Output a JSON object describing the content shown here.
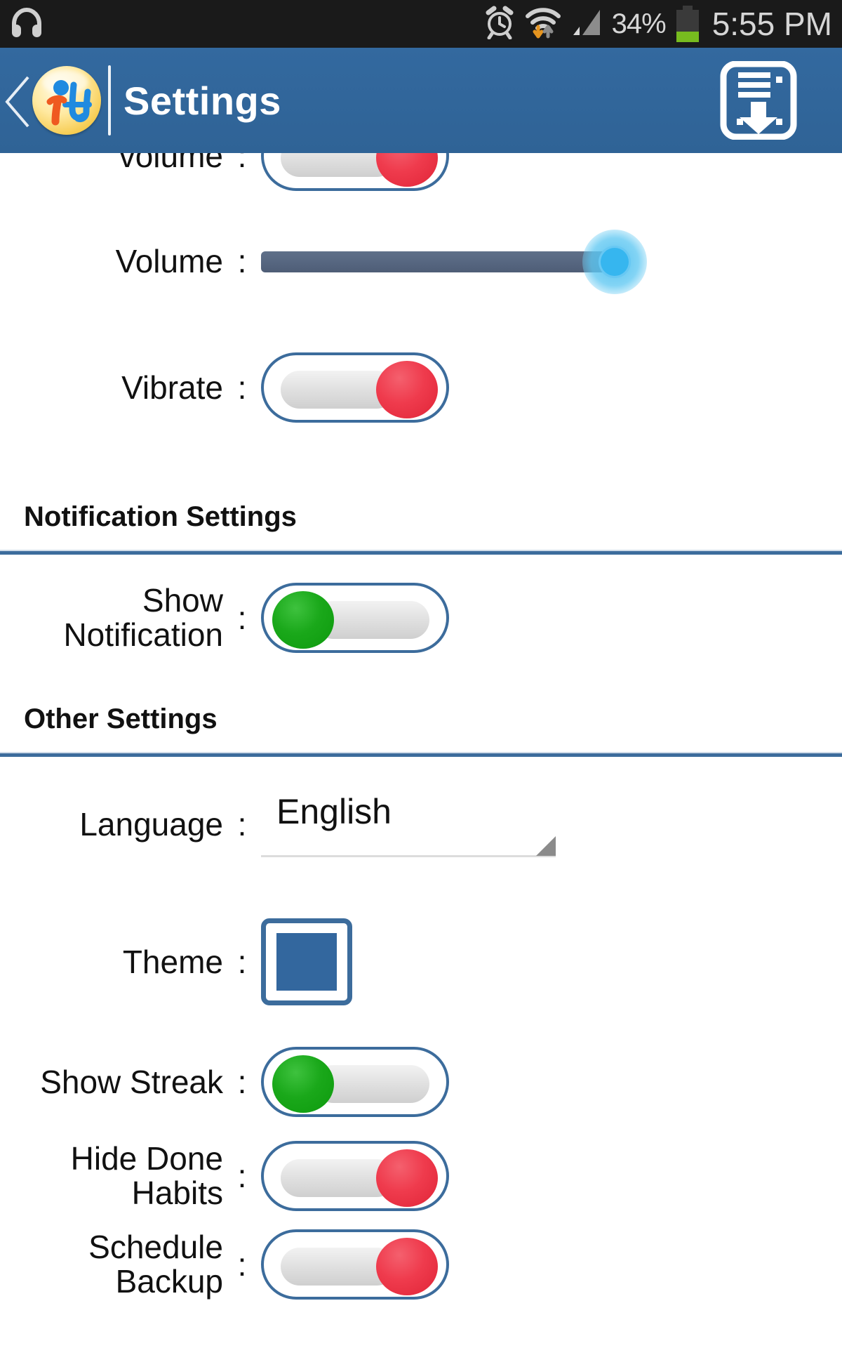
{
  "statusbar": {
    "headphones_icon": "headphones-icon",
    "alarm_icon": "alarm-clock-icon",
    "wifi_icon": "wifi-icon",
    "signal_icon": "cellular-signal-icon",
    "battery_icon": "battery-icon",
    "battery_percent": "34%",
    "time": "5:55 PM",
    "bg_color": "#1a1a1a",
    "text_color": "#d6d6d6",
    "battery_fill_color": "#77bb1f"
  },
  "appbar": {
    "back_icon": "back-chevron-icon",
    "logo_icon": "app-logo-icon",
    "logo_text_i": "i",
    "logo_text_h": "H",
    "title": "Settings",
    "save_icon": "save-floppy-download-icon",
    "bg_color": "#33699f",
    "title_color": "#ffffff"
  },
  "theme_colors": {
    "accent_blue": "#3c6c9c",
    "theme_chip": "#33679e",
    "toggle_on": "#0d9a0d",
    "toggle_off": "#e02437",
    "slider_track": "#566680",
    "slider_thumb": "#36b6ef",
    "divider": "#3c6c9c"
  },
  "sections": [
    {
      "id": "sound",
      "header": null,
      "rows": [
        {
          "label": "volume",
          "colon": ":",
          "control": "toggle",
          "state": "off",
          "clipped": true
        },
        {
          "label": "Volume",
          "colon": ":",
          "control": "slider",
          "value": 100
        },
        {
          "label": "Vibrate",
          "colon": ":",
          "control": "toggle",
          "state": "off"
        }
      ]
    },
    {
      "id": "notification",
      "header": "Notification Settings",
      "rows": [
        {
          "label": "Show\nNotification",
          "colon": ":",
          "control": "toggle",
          "state": "on"
        }
      ]
    },
    {
      "id": "other",
      "header": "Other Settings",
      "rows": [
        {
          "label": "Language",
          "colon": ":",
          "control": "spinner",
          "value": "English"
        },
        {
          "label": "Theme",
          "colon": ":",
          "control": "swatch",
          "value": "#33679e"
        },
        {
          "label": "Show Streak",
          "colon": ":",
          "control": "toggle",
          "state": "on"
        },
        {
          "label": "Hide Done\nHabits",
          "colon": ":",
          "control": "toggle",
          "state": "off"
        },
        {
          "label": "Schedule\nBackup",
          "colon": ":",
          "control": "toggle",
          "state": "off"
        }
      ]
    }
  ],
  "labels": {
    "volume_partial": "volume",
    "volume": "Volume",
    "vibrate": "Vibrate",
    "notification_settings": "Notification Settings",
    "show_notification_l1": "Show",
    "show_notification_l2": "Notification",
    "other_settings": "Other Settings",
    "language": "Language",
    "language_value": "English",
    "theme": "Theme",
    "show_streak": "Show Streak",
    "hide_done_l1": "Hide Done",
    "hide_done_l2": "Habits",
    "schedule_backup_l1": "Schedule",
    "schedule_backup_l2": "Backup",
    "colon": ":"
  }
}
